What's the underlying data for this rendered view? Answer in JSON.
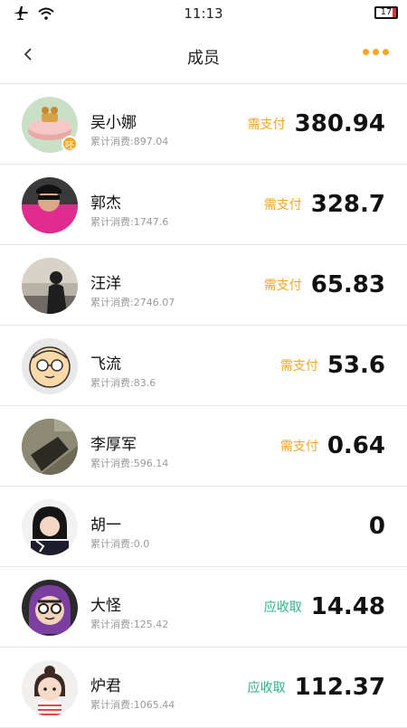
{
  "status_bar": {
    "time": "11:13",
    "battery": "17",
    "battery_level": 0.17,
    "colors": {
      "battery_low": "#e5322d"
    }
  },
  "nav": {
    "title": "成员"
  },
  "colors": {
    "accent": "#f5a623",
    "pay": "#f5a623",
    "receive": "#2fb08a"
  },
  "members": [
    {
      "name": "吴小娜",
      "spend": "累计消费:897.04",
      "status": "需支付",
      "status_type": "pay",
      "amount": "380.94",
      "badge": "呸",
      "avatar_icon": "cake-icon"
    },
    {
      "name": "郭杰",
      "spend": "累计消费:1747.6",
      "status": "需支付",
      "status_type": "pay",
      "amount": "328.7",
      "avatar_icon": "photo-icon"
    },
    {
      "name": "汪洋",
      "spend": "累计消费:2746.07",
      "status": "需支付",
      "status_type": "pay",
      "amount": "65.83",
      "avatar_icon": "photo-icon"
    },
    {
      "name": "飞流",
      "spend": "累计消费:83.6",
      "status": "需支付",
      "status_type": "pay",
      "amount": "53.6",
      "avatar_icon": "glasses-face-icon"
    },
    {
      "name": "李厚军",
      "spend": "累计消费:596.14",
      "status": "需支付",
      "status_type": "pay",
      "amount": "0.64",
      "avatar_icon": "photo-icon"
    },
    {
      "name": "胡一",
      "spend": "累计消费:0.0",
      "status": "",
      "status_type": "none",
      "amount": "0",
      "avatar_icon": "photo-icon"
    },
    {
      "name": "大怪",
      "spend": "累计消费:125.42",
      "status": "应收取",
      "status_type": "receive",
      "amount": "14.48",
      "avatar_icon": "purple-hair-face-icon"
    },
    {
      "name": "炉君",
      "spend": "累计消费:1065.44",
      "status": "应收取",
      "status_type": "receive",
      "amount": "112.37",
      "avatar_icon": "girl-face-icon"
    }
  ]
}
